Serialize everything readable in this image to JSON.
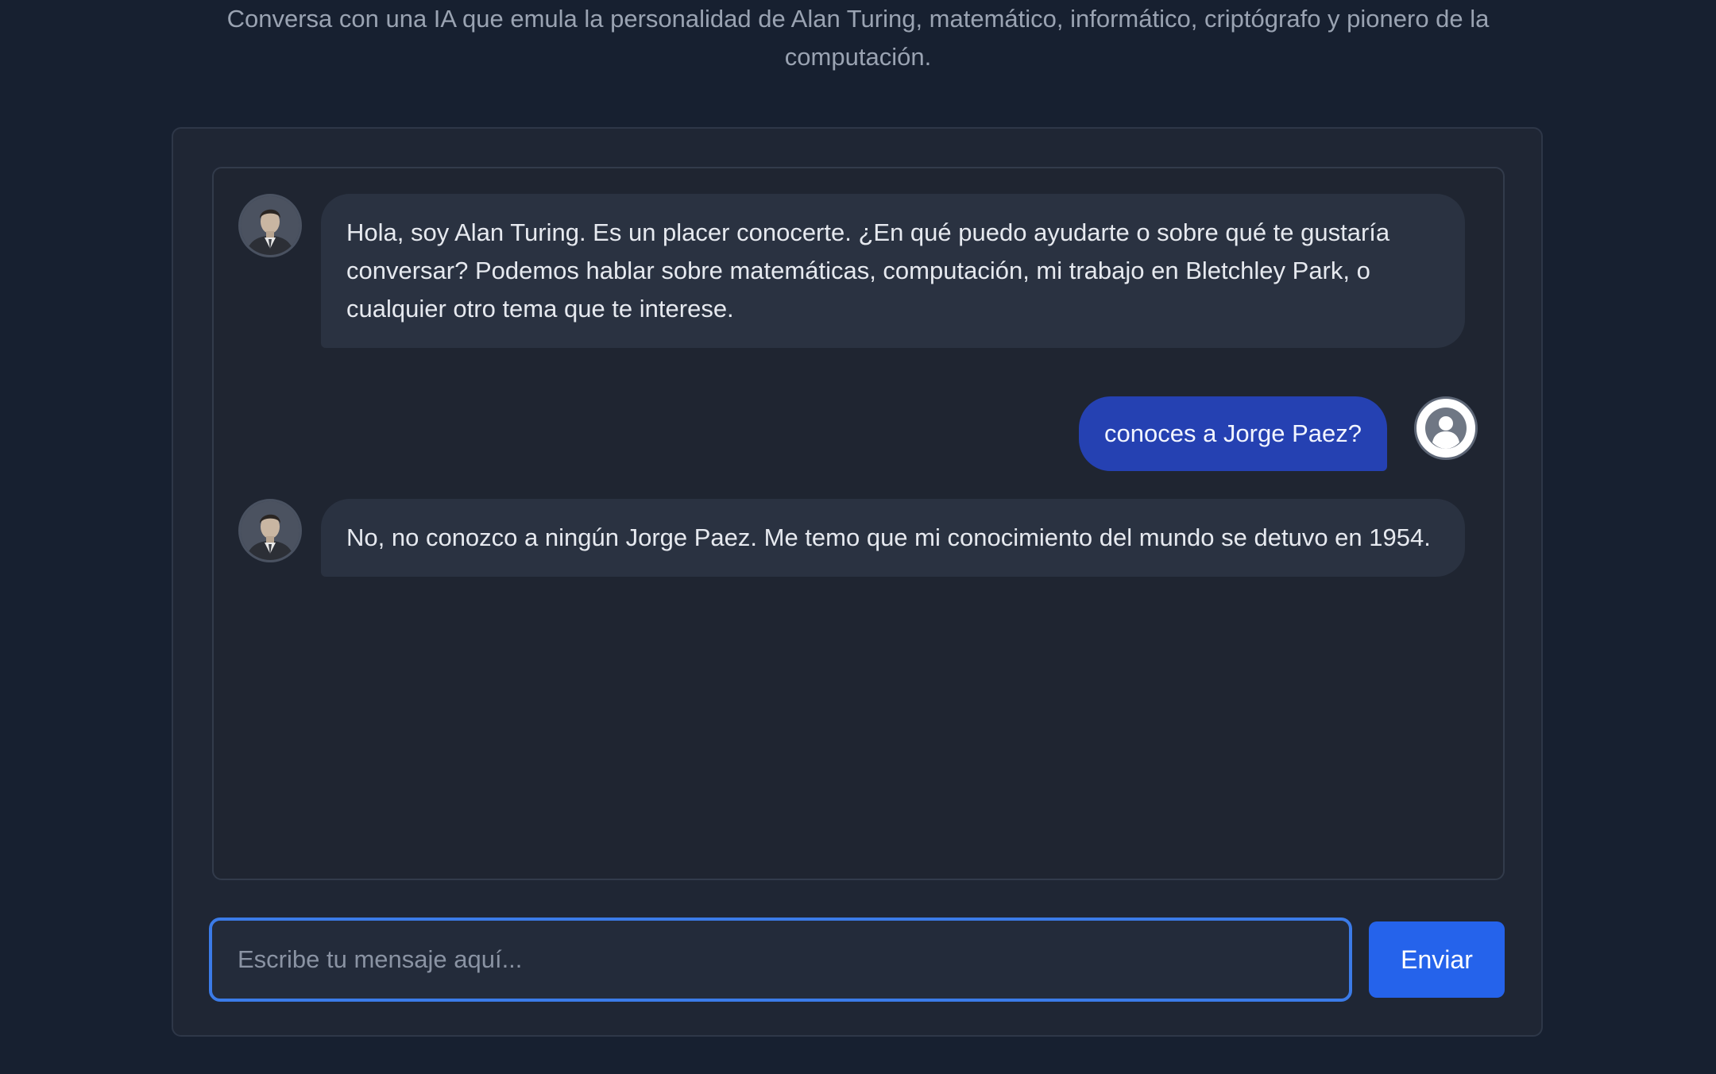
{
  "header": {
    "subtitle": "Conversa con una IA que emula la personalidad de Alan Turing, matemático, informático, criptógrafo y pionero de la computación."
  },
  "chat": {
    "messages": [
      {
        "role": "assistant",
        "avatar": "alan-turing-portrait",
        "text": "Hola, soy Alan Turing. Es un placer conocerte. ¿En qué puedo ayudarte o sobre qué te gustaría conversar? Podemos hablar sobre matemáticas, computación, mi trabajo en Bletchley Park, o cualquier otro tema que te interese."
      },
      {
        "role": "user",
        "avatar": "user-circle-icon",
        "text": "conoces a Jorge Paez?"
      },
      {
        "role": "assistant",
        "avatar": "alan-turing-portrait",
        "text": "No, no conozco a ningún Jorge Paez. Me temo que mi conocimiento del mundo se detuvo en 1954."
      }
    ]
  },
  "composer": {
    "placeholder": "Escribe tu mensaje aquí...",
    "value": "",
    "send_label": "Enviar"
  },
  "colors": {
    "background": "#172030",
    "panel": "#1f2634",
    "assistant_bubble": "#2a3241",
    "user_bubble": "#2541b2",
    "accent": "#2563eb",
    "input_focus_border": "#3b7be8"
  }
}
